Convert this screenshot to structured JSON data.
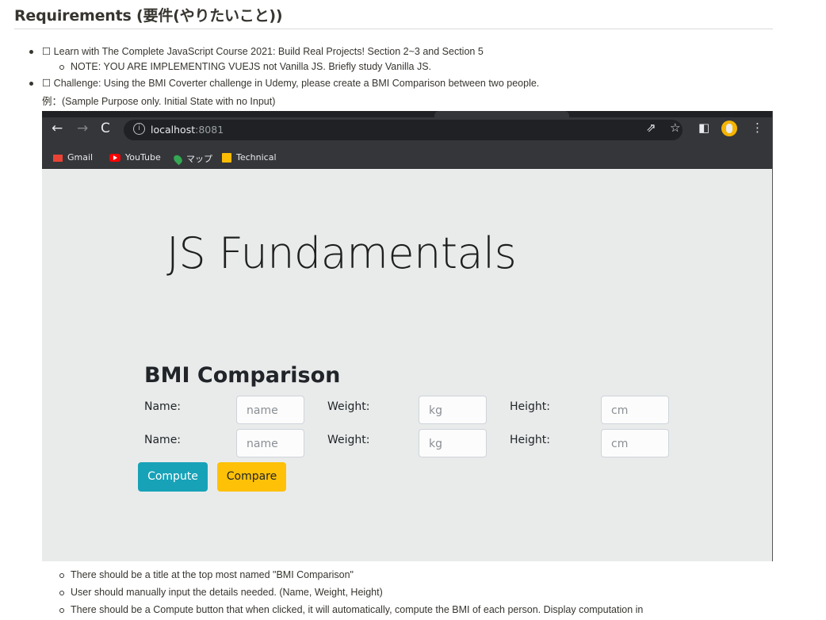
{
  "doc": {
    "title": "Requirements (要件(やりたいこと))",
    "bullet1": "☐ Learn with The Complete JavaScript Course 2021: Build Real Projects! Section 2~3 and Section 5",
    "bullet1_note": "NOTE: YOU ARE IMPLEMENTING VUEJS not Vanilla JS. Briefly study Vanilla JS.",
    "bullet2": "☐ Challenge: Using the BMI Coverter challenge in Udemy, please create a BMI Comparison between two people.",
    "bullet2_example": "例：(Sample Purpose only. Initial State with no Input)",
    "sub_items": [
      "There should be a title at the top most named \"BMI Comparison\"",
      "User should manually input the details needed. (Name, Weight, Height)",
      "There should be a Compute button that when clicked, it will automatically, compute the BMI of each person. Display computation in"
    ]
  },
  "browser": {
    "url_host": "localhost",
    "url_port": ":8081",
    "bookmarks": [
      "Gmail",
      "YouTube",
      "マップ",
      "Technical"
    ]
  },
  "app": {
    "jumbotron_title": "JS Fundamentals",
    "section_title": "BMI Comparison",
    "rows": [
      {
        "name_label": "Name:",
        "name_placeholder": "name",
        "weight_label": "Weight:",
        "weight_placeholder": "kg",
        "height_label": "Height:",
        "height_placeholder": "cm"
      },
      {
        "name_label": "Name:",
        "name_placeholder": "name",
        "weight_label": "Weight:",
        "weight_placeholder": "kg",
        "height_label": "Height:",
        "height_placeholder": "cm"
      }
    ],
    "compute_label": "Compute",
    "compare_label": "Compare"
  }
}
